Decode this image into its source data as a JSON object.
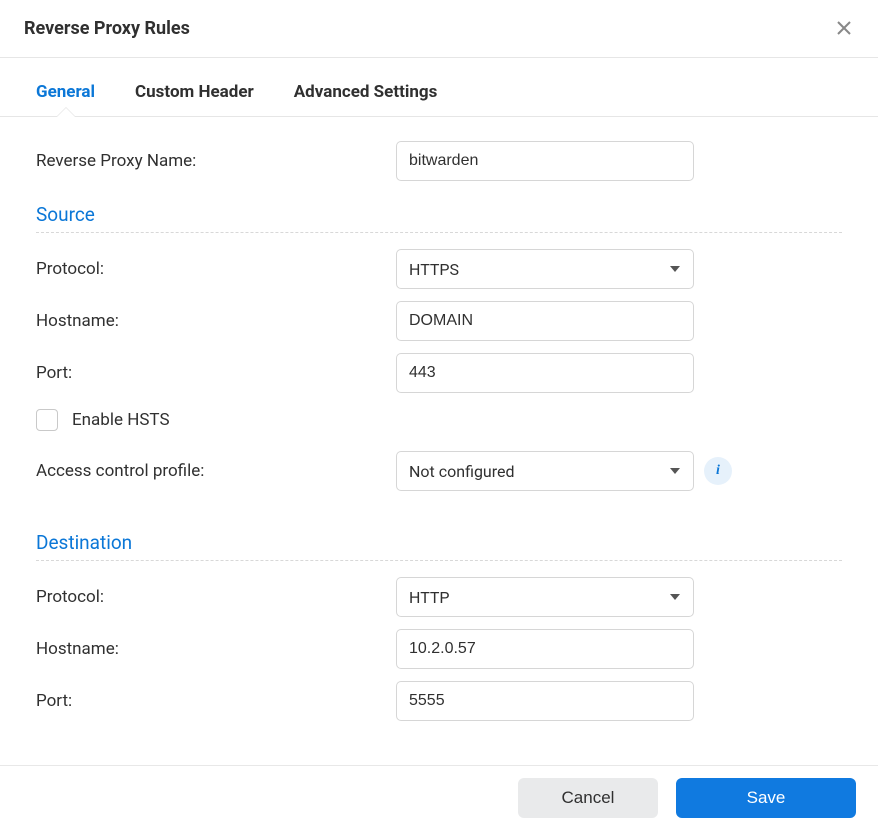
{
  "header": {
    "title": "Reverse Proxy Rules"
  },
  "tabs": [
    {
      "label": "General",
      "active": true
    },
    {
      "label": "Custom Header",
      "active": false
    },
    {
      "label": "Advanced Settings",
      "active": false
    }
  ],
  "form": {
    "name": {
      "label": "Reverse Proxy Name:",
      "value": "bitwarden"
    },
    "source": {
      "title": "Source",
      "protocol": {
        "label": "Protocol:",
        "value": "HTTPS"
      },
      "hostname": {
        "label": "Hostname:",
        "value": "DOMAIN"
      },
      "port": {
        "label": "Port:",
        "value": "443"
      },
      "hsts": {
        "label": "Enable HSTS",
        "checked": false
      },
      "access": {
        "label": "Access control profile:",
        "value": "Not configured"
      }
    },
    "destination": {
      "title": "Destination",
      "protocol": {
        "label": "Protocol:",
        "value": "HTTP"
      },
      "hostname": {
        "label": "Hostname:",
        "value": "10.2.0.57"
      },
      "port": {
        "label": "Port:",
        "value": "5555"
      }
    }
  },
  "footer": {
    "cancel": "Cancel",
    "save": "Save"
  }
}
